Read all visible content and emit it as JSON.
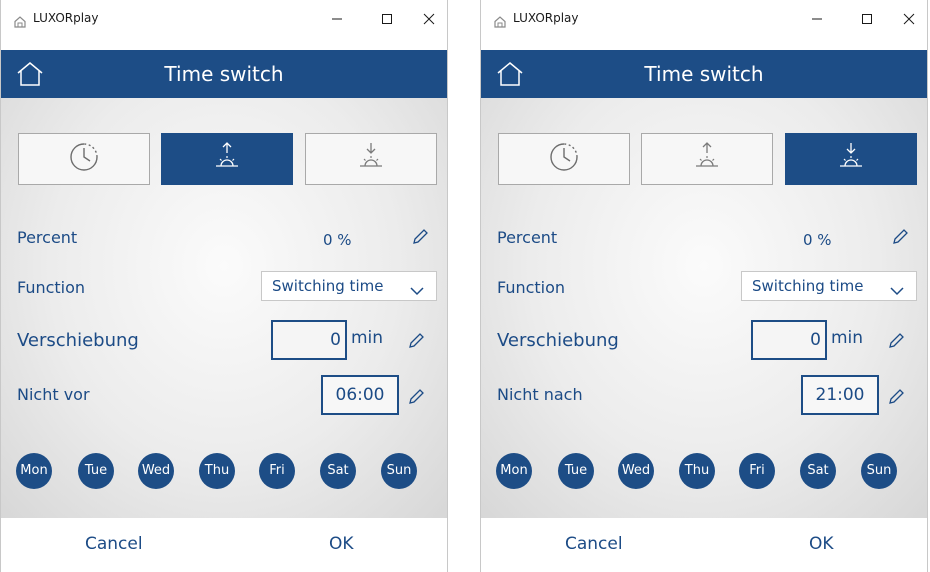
{
  "windows": [
    {
      "app_title": "LUXORplay",
      "header_title": "Time switch",
      "active_mode": "sunrise",
      "percent_label": "Percent",
      "percent_value": "0 %",
      "function_label": "Function",
      "function_value": "Switching time",
      "shift_label": "Verschiebung",
      "shift_value": "0",
      "shift_unit": "min",
      "limit_label": "Nicht vor",
      "limit_value": "06:00",
      "days": [
        "Mon",
        "Tue",
        "Wed",
        "Thu",
        "Fri",
        "Sat",
        "Sun"
      ],
      "cancel_label": "Cancel",
      "ok_label": "OK"
    },
    {
      "app_title": "LUXORplay",
      "header_title": "Time switch",
      "active_mode": "sunset",
      "percent_label": "Percent",
      "percent_value": "0 %",
      "function_label": "Function",
      "function_value": "Switching time",
      "shift_label": "Verschiebung",
      "shift_value": "0",
      "shift_unit": "min",
      "limit_label": "Nicht nach",
      "limit_value": "21:00",
      "days": [
        "Mon",
        "Tue",
        "Wed",
        "Thu",
        "Fri",
        "Sat",
        "Sun"
      ],
      "cancel_label": "Cancel",
      "ok_label": "OK"
    }
  ],
  "icons": {
    "app": "house-small-icon",
    "home": "home-icon",
    "mode_time": "clock-icon",
    "mode_sunrise": "sunrise-icon",
    "mode_sunset": "sunset-icon",
    "edit": "pencil-icon",
    "dropdown": "chevron-down-icon",
    "minimize": "minimize-icon",
    "maximize": "maximize-icon",
    "close": "close-icon"
  },
  "colors": {
    "accent": "#1d4d86",
    "text": "#1c4b86",
    "button_bg": "#f7f7f7"
  }
}
